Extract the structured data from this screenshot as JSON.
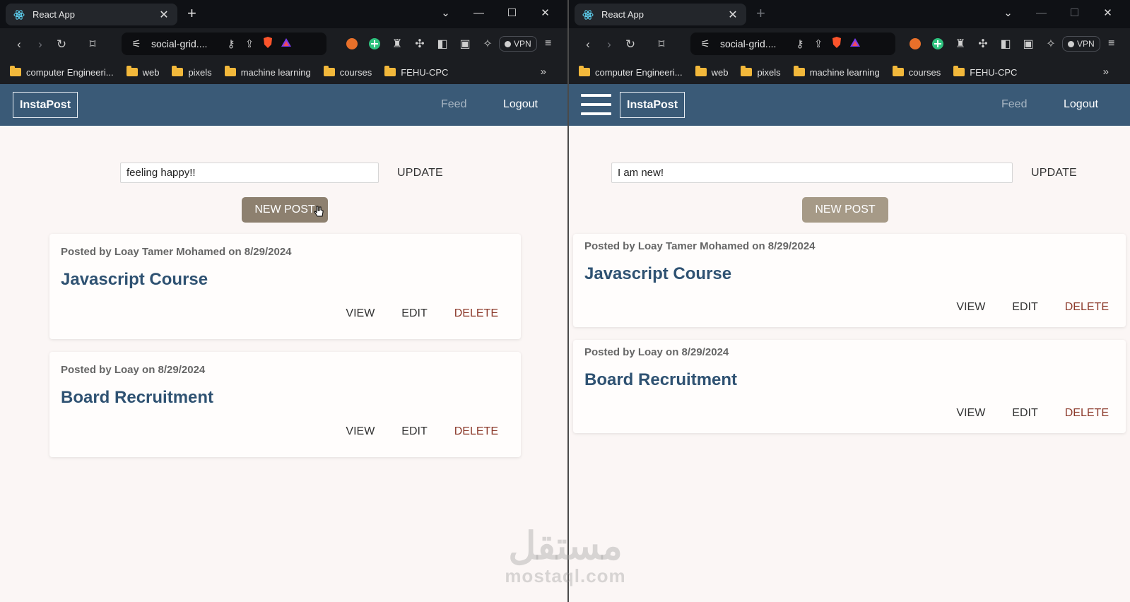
{
  "colors": {
    "nav_bg": "#3a5a77",
    "accent_title": "#2f5272",
    "delete": "#8c3a2b",
    "newpost_btn": "#8d806f",
    "page_bg": "#fbf6f5"
  },
  "left": {
    "tab_title": "React App",
    "url": "social-grid....",
    "bookmarks": [
      "computer Engineeri...",
      "web",
      "pixels",
      "machine learning",
      "courses",
      "FEHU-CPC"
    ],
    "vpn_label": "VPN",
    "brand": "InstaPost",
    "nav": {
      "feed": "Feed",
      "logout": "Logout"
    },
    "composer": {
      "value": "feeling happy!!",
      "update": "UPDATE",
      "new_post": "NEW POST"
    },
    "posts": [
      {
        "meta": "Posted by Loay Tamer Mohamed on 8/29/2024",
        "title": "Javascript Course",
        "view": "VIEW",
        "edit": "EDIT",
        "delete": "DELETE"
      },
      {
        "meta": "Posted by Loay on 8/29/2024",
        "title": "Board Recruitment",
        "view": "VIEW",
        "edit": "EDIT",
        "delete": "DELETE"
      }
    ]
  },
  "right": {
    "tab_title": "React App",
    "url": "social-grid....",
    "bookmarks": [
      "computer Engineeri...",
      "web",
      "pixels",
      "machine learning",
      "courses",
      "FEHU-CPC"
    ],
    "vpn_label": "VPN",
    "brand": "InstaPost",
    "nav": {
      "feed": "Feed",
      "logout": "Logout"
    },
    "composer": {
      "value": "I am new!",
      "update": "UPDATE",
      "new_post": "NEW POST"
    },
    "posts": [
      {
        "meta": "Posted by Loay Tamer Mohamed on 8/29/2024",
        "title": "Javascript Course",
        "view": "VIEW",
        "edit": "EDIT",
        "delete": "DELETE"
      },
      {
        "meta": "Posted by Loay on 8/29/2024",
        "title": "Board Recruitment",
        "view": "VIEW",
        "edit": "EDIT",
        "delete": "DELETE"
      }
    ]
  },
  "watermark": {
    "arabic": "مستقل",
    "latin": "mostaql.com"
  }
}
